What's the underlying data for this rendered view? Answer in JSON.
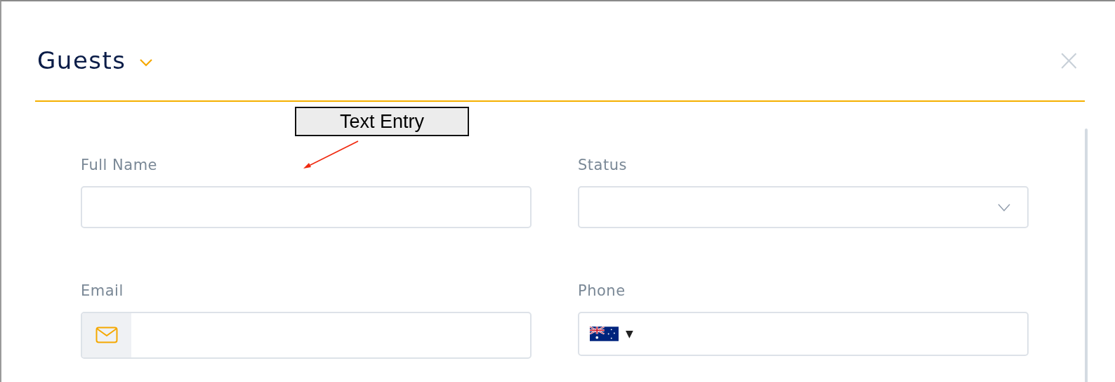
{
  "modal": {
    "title": "Guests",
    "close": "×"
  },
  "annotation": {
    "label": "Text Entry"
  },
  "fields": [
    {
      "kind": "text",
      "label": "Full Name"
    },
    {
      "kind": "select",
      "label": "Status"
    },
    {
      "kind": "email",
      "label": "Email"
    },
    {
      "kind": "phone",
      "label": "Phone",
      "country_caret": "▼"
    }
  ]
}
